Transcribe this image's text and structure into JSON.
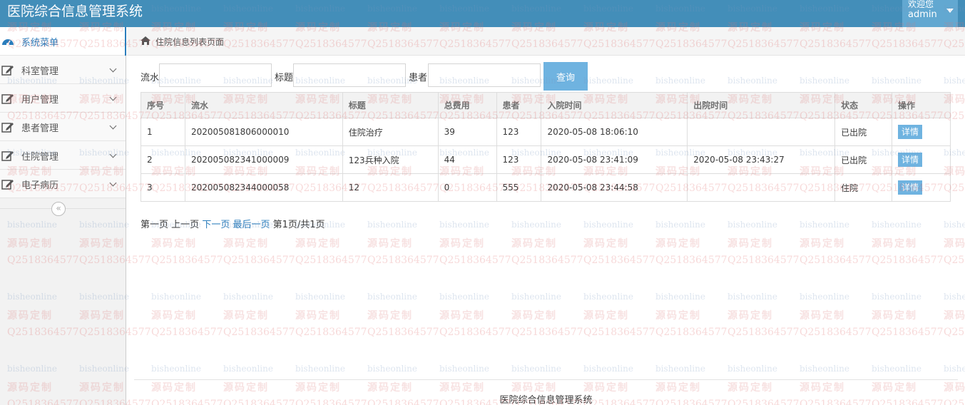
{
  "app": {
    "title": "医院综合信息管理系统",
    "welcome": "欢迎您",
    "username": "admin"
  },
  "sidebar": {
    "items": [
      {
        "label": "系统菜单",
        "icon": "dashboard-icon"
      },
      {
        "label": "科室管理",
        "icon": "edit-icon"
      },
      {
        "label": "用户管理",
        "icon": "edit-icon"
      },
      {
        "label": "患者管理",
        "icon": "edit-icon"
      },
      {
        "label": "住院管理",
        "icon": "edit-icon"
      },
      {
        "label": "电子病历",
        "icon": "edit-icon"
      }
    ],
    "collapse_glyph": "«"
  },
  "breadcrumb": {
    "text": "住院信息列表页面",
    "icon": "home-icon"
  },
  "search": {
    "liushui_label": "流水",
    "liushui_value": "",
    "title_label": "标题",
    "title_value": "",
    "patient_label": "患者",
    "patient_value": "",
    "button_label": "查询"
  },
  "table": {
    "headers": [
      "序号",
      "流水",
      "标题",
      "总费用",
      "患者",
      "入院时间",
      "出院时间",
      "状态",
      "操作"
    ],
    "rows": [
      {
        "no": "1",
        "serial": "202005081806000010",
        "title": "住院治疗",
        "cost": "39",
        "patient": "123",
        "admit": "2020-05-08 18:06:10",
        "discharge": "",
        "status": "已出院",
        "action": "详情"
      },
      {
        "no": "2",
        "serial": "202005082341000009",
        "title": "123兵种入院",
        "cost": "44",
        "patient": "123",
        "admit": "2020-05-08 23:41:09",
        "discharge": "2020-05-08 23:43:27",
        "status": "已出院",
        "action": "详情"
      },
      {
        "no": "3",
        "serial": "202005082344000058",
        "title": "12",
        "cost": "0",
        "patient": "555",
        "admit": "2020-05-08 23:44:58",
        "discharge": "",
        "status": "住院",
        "action": "详情"
      }
    ]
  },
  "pager": {
    "first": "第一页",
    "prev": "上一页",
    "next": "下一页",
    "last": "最后一页",
    "info": "第1页/共1页"
  },
  "footer": {
    "text": "医院综合信息管理系统"
  },
  "watermark": {
    "line1": "bisheonline",
    "line2": "源码定制",
    "line3": "Q2518364577"
  },
  "colors": {
    "navbar": "#438eb9",
    "accent": "#2b7dbc",
    "button": "#6fb3e0"
  }
}
